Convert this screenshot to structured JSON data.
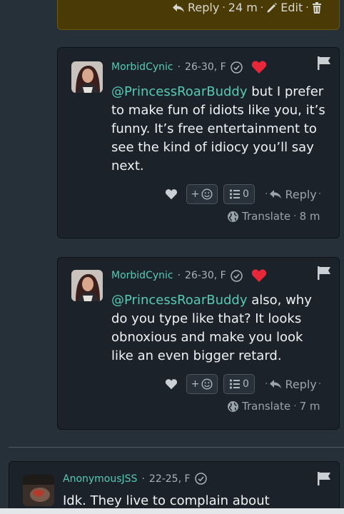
{
  "top_comment": {
    "reply_label": "Reply",
    "time": "24 m",
    "edit_label": "Edit"
  },
  "comments": [
    {
      "username": "MorbidCynic",
      "demographics": "26-30, F",
      "mention": "@PrincessRoarBuddy",
      "text": " but I prefer to make fun of idiots like you, it’s funny. It’s free entertainment to see the kind of idiocy you’ll say next.",
      "reaction_add": "+",
      "list_count": "0",
      "reply_label": "Reply",
      "translate_label": "Translate",
      "time": "8 m"
    },
    {
      "username": "MorbidCynic",
      "demographics": "26-30, F",
      "mention": "@PrincessRoarBuddy",
      "text": " also, why do you type like that? It looks obnoxious and make you look like an even bigger retard.",
      "reaction_add": "+",
      "list_count": "0",
      "reply_label": "Reply",
      "translate_label": "Translate",
      "time": "7 m"
    }
  ],
  "bottom_comment": {
    "username": "AnonymousJSS",
    "demographics": "22-25, F",
    "text": "Idk. They live to complain about"
  },
  "colors": {
    "background": "#263038",
    "card": "#1b2229",
    "own_card": "#4a3a06",
    "accent": "#58c9b5",
    "heart": "#e8283a"
  },
  "icons": [
    "reply-icon",
    "edit-icon",
    "trash-icon",
    "heart-icon",
    "verified-icon",
    "flag-icon",
    "emoji-icon",
    "list-icon",
    "globe-icon"
  ]
}
